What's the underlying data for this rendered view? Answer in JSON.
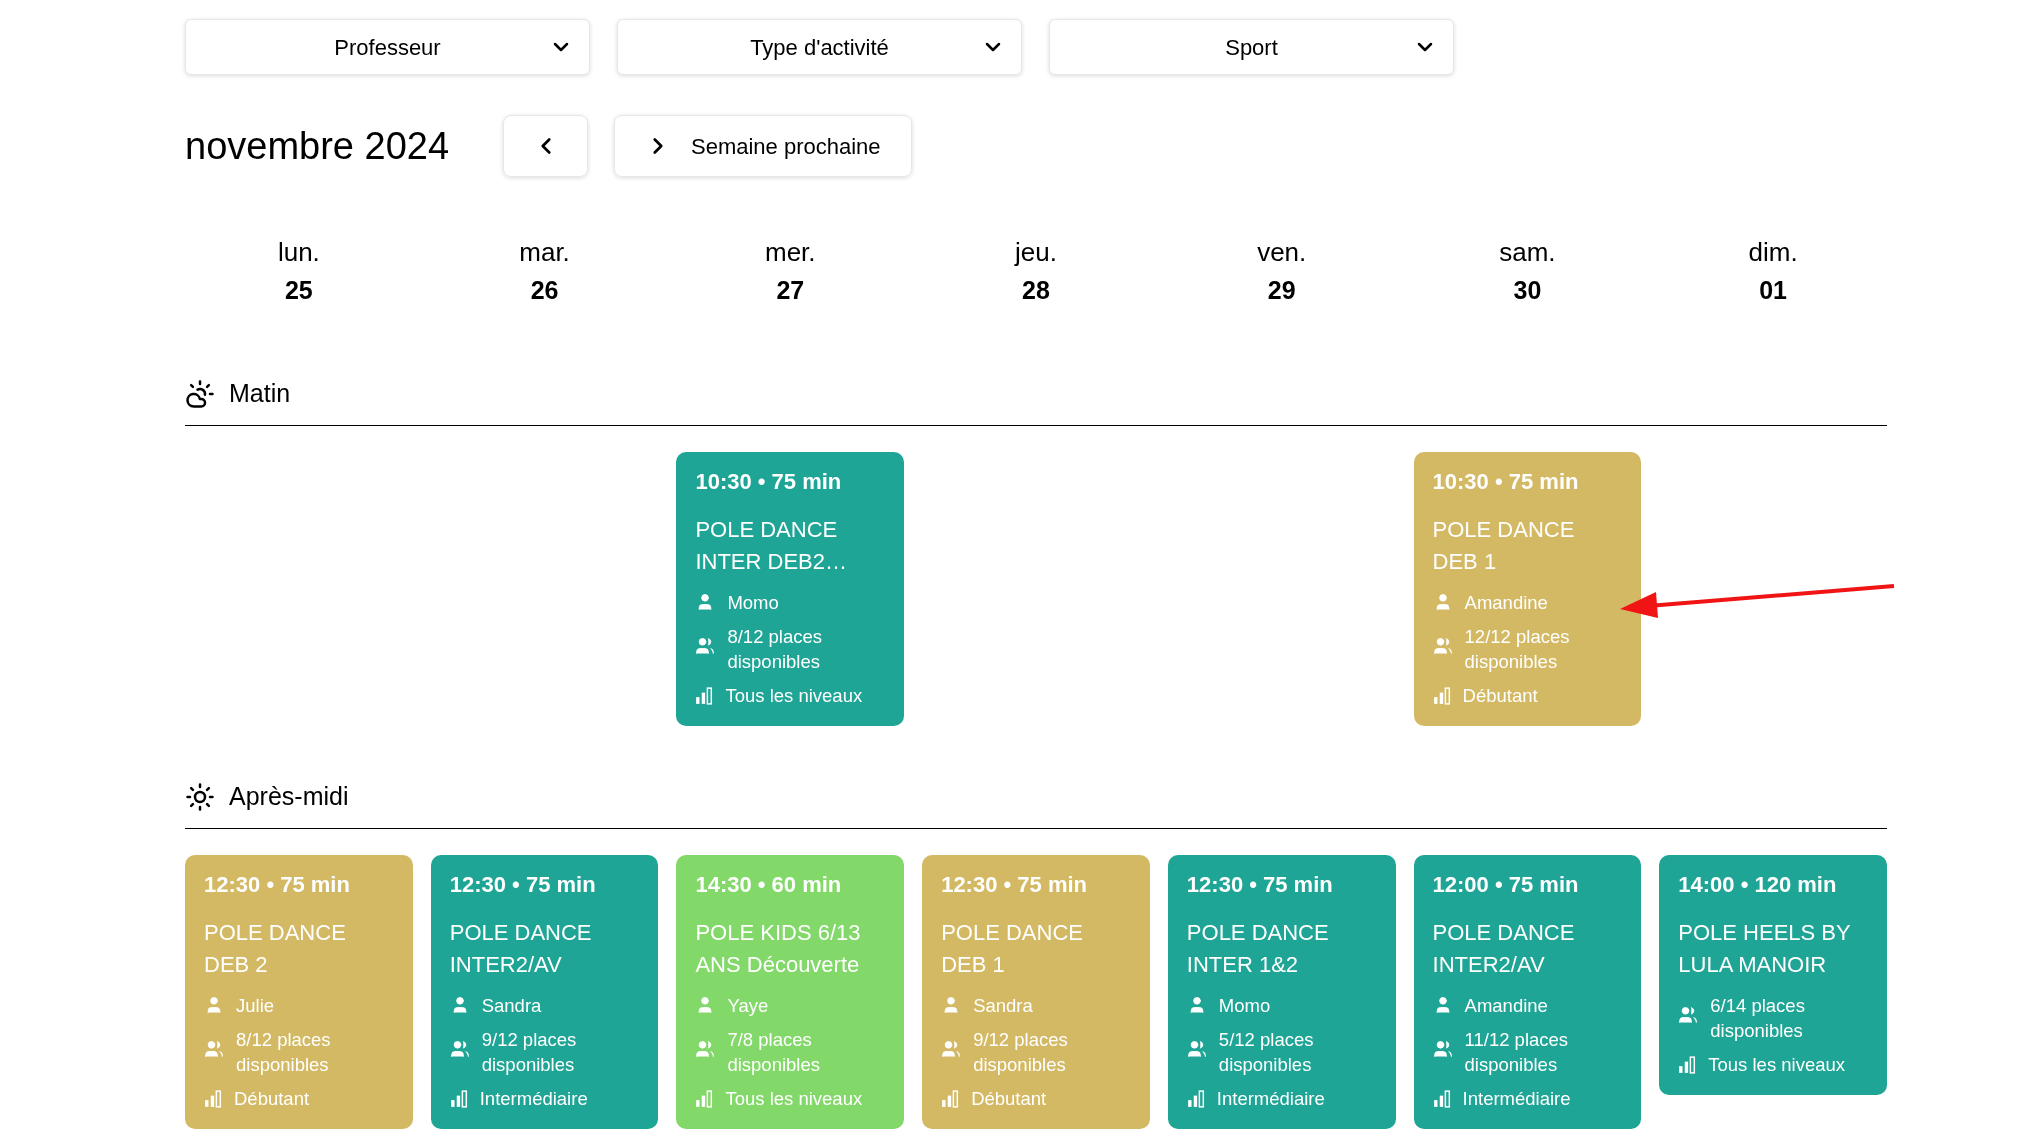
{
  "filters": [
    {
      "label": "Professeur"
    },
    {
      "label": "Type d'activité"
    },
    {
      "label": "Sport"
    }
  ],
  "month": "novembre 2024",
  "nav": {
    "next_label": "Semaine prochaine"
  },
  "days": [
    {
      "name": "lun.",
      "date": "25"
    },
    {
      "name": "mar.",
      "date": "26"
    },
    {
      "name": "mer.",
      "date": "27"
    },
    {
      "name": "jeu.",
      "date": "28"
    },
    {
      "name": "ven.",
      "date": "29"
    },
    {
      "name": "sam.",
      "date": "30"
    },
    {
      "name": "dim.",
      "date": "01"
    }
  ],
  "sections": [
    {
      "title": "Matin",
      "kind": "morning",
      "columns": [
        [],
        [],
        [
          {
            "time": "10:30 • 75 min",
            "title": "POLE DANCE INTER DEB2…",
            "teacher": "Momo",
            "places": "8/12 places disponibles",
            "level": "Tous les niveaux",
            "color": "#1fa595"
          }
        ],
        [],
        [],
        [
          {
            "time": "10:30 • 75 min",
            "title": "POLE DANCE DEB 1",
            "teacher": "Amandine",
            "places": "12/12 places disponibles",
            "level": "Débutant",
            "color": "#d4b964"
          }
        ],
        []
      ]
    },
    {
      "title": "Après-midi",
      "kind": "afternoon",
      "columns": [
        [
          {
            "time": "12:30 • 75 min",
            "title": "POLE DANCE DEB 2",
            "teacher": "Julie",
            "places": "8/12 places disponibles",
            "level": "Débutant",
            "color": "#d4b964"
          }
        ],
        [
          {
            "time": "12:30 • 75 min",
            "title": "POLE DANCE INTER2/AV",
            "teacher": "Sandra",
            "places": "9/12 places disponibles",
            "level": "Intermédiaire",
            "color": "#1fa595"
          }
        ],
        [
          {
            "time": "14:30 • 60 min",
            "title": "POLE KIDS 6/13 ANS Découverte",
            "teacher": "Yaye",
            "places": "7/8 places disponibles",
            "level": "Tous les niveaux",
            "color": "#83d86a"
          }
        ],
        [
          {
            "time": "12:30 • 75 min",
            "title": "POLE DANCE DEB 1",
            "teacher": "Sandra",
            "places": "9/12 places disponibles",
            "level": "Débutant",
            "color": "#d4b964"
          }
        ],
        [
          {
            "time": "12:30 • 75 min",
            "title": "POLE DANCE INTER 1&2",
            "teacher": "Momo",
            "places": "5/12 places disponibles",
            "level": "Intermédiaire",
            "color": "#1fa595"
          }
        ],
        [
          {
            "time": "12:00 • 75 min",
            "title": "POLE DANCE INTER2/AV",
            "teacher": "Amandine",
            "places": "11/12 places disponibles",
            "level": "Intermédiaire",
            "color": "#1fa595"
          }
        ],
        [
          {
            "time": "14:00 • 120 min",
            "title": "POLE HEELS BY LULA MANOIR",
            "places": "6/14 places disponibles",
            "level": "Tous les niveaux",
            "color": "#1fa595"
          }
        ]
      ]
    }
  ]
}
